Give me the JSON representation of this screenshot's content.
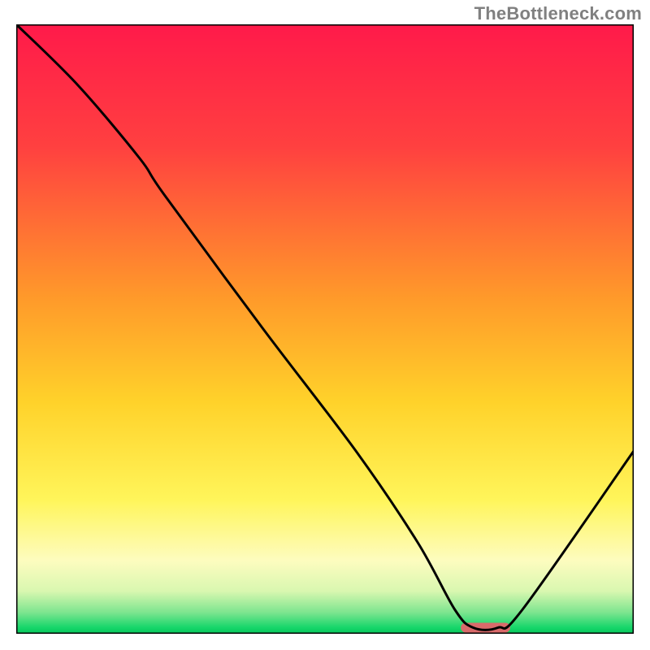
{
  "attribution": "TheBottleneck.com",
  "chart_data": {
    "type": "line",
    "title": "",
    "xlabel": "",
    "ylabel": "",
    "xlim": [
      0,
      100
    ],
    "ylim": [
      0,
      100
    ],
    "grid": false,
    "x": [
      0,
      10,
      20,
      24,
      40,
      55,
      65,
      71,
      74,
      78,
      82,
      100
    ],
    "values": [
      100,
      90,
      78,
      72,
      50,
      30,
      15,
      4,
      1,
      1,
      4,
      30
    ],
    "minimum_marker": {
      "x_start": 72,
      "x_end": 80,
      "y": 1,
      "color": "#d96a6a"
    },
    "gradient_stops": [
      {
        "offset": 0.0,
        "color": "#ff1a4a"
      },
      {
        "offset": 0.2,
        "color": "#ff4040"
      },
      {
        "offset": 0.45,
        "color": "#ff9a2a"
      },
      {
        "offset": 0.62,
        "color": "#ffd22a"
      },
      {
        "offset": 0.78,
        "color": "#fff55a"
      },
      {
        "offset": 0.88,
        "color": "#fdfcbf"
      },
      {
        "offset": 0.93,
        "color": "#d9f7b0"
      },
      {
        "offset": 0.965,
        "color": "#7de58f"
      },
      {
        "offset": 0.99,
        "color": "#16d66a"
      },
      {
        "offset": 1.0,
        "color": "#08c85c"
      }
    ]
  }
}
